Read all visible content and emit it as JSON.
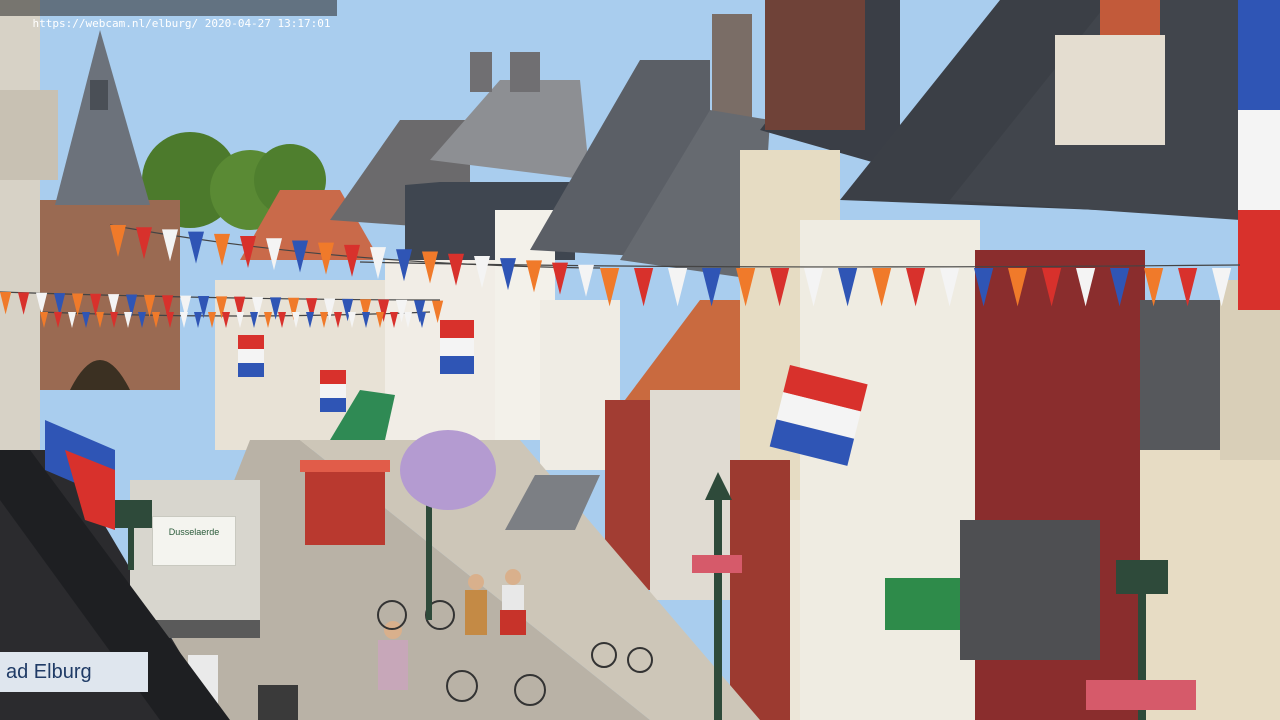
{
  "overlay": {
    "url": "https://webcam.nl/elburg/",
    "timestamp": "2020-04-27 13:17:01"
  },
  "scene": {
    "sign_text": "ad Elburg",
    "truck_text": "Dusselaerde",
    "colors": {
      "sky": "#a9cdee",
      "street": "#b9b2a6",
      "brick_red": "#8a2d2d",
      "roof_dark": "#3b3e44",
      "flag_red": "#d8312c",
      "flag_white": "#f4f4f4",
      "flag_blue": "#2f55b5",
      "flag_orange": "#f07a2a",
      "tree_green": "#4c7a2c"
    }
  }
}
